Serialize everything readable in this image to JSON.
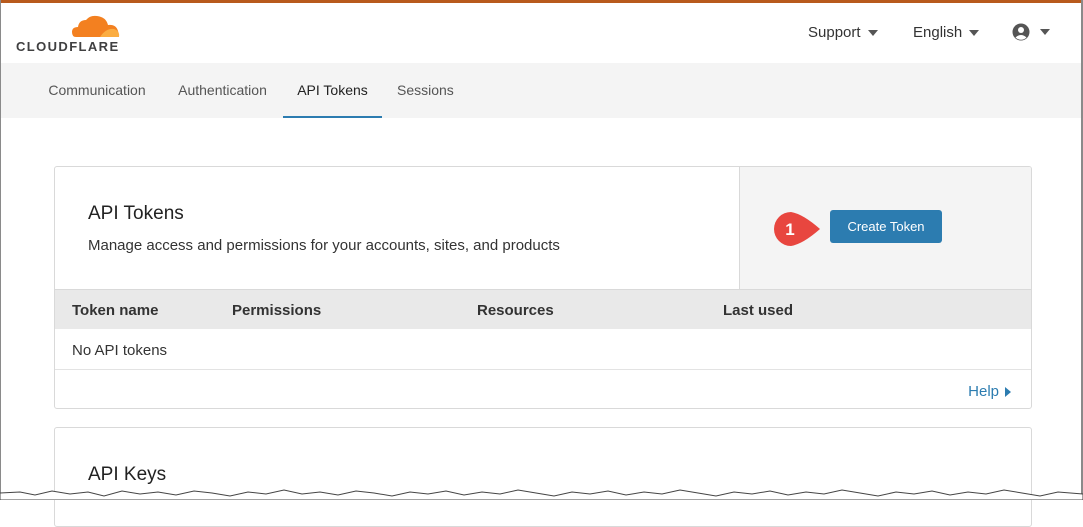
{
  "header": {
    "logo_text": "CLOUDFLARE",
    "support_label": "Support",
    "language_label": "English"
  },
  "tabs": [
    {
      "label": "Communication",
      "active": false
    },
    {
      "label": "Authentication",
      "active": false
    },
    {
      "label": "API Tokens",
      "active": true
    },
    {
      "label": "Sessions",
      "active": false
    }
  ],
  "api_tokens": {
    "title": "API Tokens",
    "description": "Manage access and permissions for your accounts, sites, and products",
    "create_button": "Create Token",
    "callout_number": "1",
    "columns": [
      "Token name",
      "Permissions",
      "Resources",
      "Last used"
    ],
    "empty_message": "No API tokens",
    "help_link": "Help"
  },
  "api_keys": {
    "title": "API Keys"
  },
  "colors": {
    "brand_orange": "#f38020",
    "accent_blue": "#2c7cb0",
    "callout_red": "#e8463f"
  },
  "icons": {
    "logo": "cloudflare-cloud-icon",
    "user": "user-circle-icon",
    "dropdown": "caret-down-icon",
    "help": "triangle-right-icon"
  }
}
